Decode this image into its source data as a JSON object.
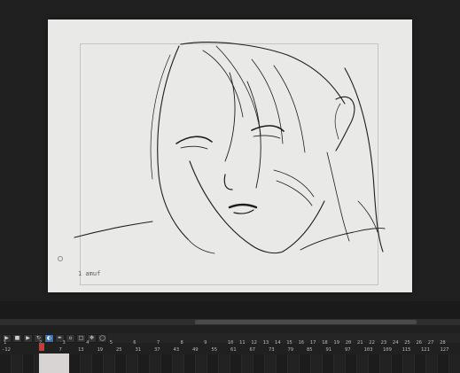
{
  "canvas": {
    "scene_label": "1 amuf",
    "line_color": "#1a1a1a",
    "paper_color": "#e9e9e7"
  },
  "timeline": {
    "toolbar_icons": [
      "play-icon",
      "stop-icon",
      "next-frame-icon",
      "loop-icon",
      "onion-skin-icon",
      "brush-icon",
      "eraser-icon",
      "select-icon",
      "move-icon",
      "zoom-icon"
    ],
    "upper_ticks": [
      "1",
      "",
      "",
      "2",
      "",
      "3",
      "",
      "4",
      "",
      "5",
      "",
      "6",
      "",
      "7",
      "",
      "8",
      "",
      "9",
      "",
      "10",
      "11",
      "12",
      "13",
      "14",
      "15",
      "16",
      "17",
      "18",
      "19",
      "20",
      "21",
      "22",
      "23",
      "24",
      "25",
      "26",
      "27",
      "28"
    ],
    "lower_ticks": [
      "-12",
      "",
      "1",
      "7",
      "13",
      "19",
      "25",
      "31",
      "37",
      "43",
      "49",
      "55",
      "61",
      "67",
      "73",
      "79",
      "85",
      "91",
      "97",
      "103",
      "109",
      "115",
      "121",
      "127"
    ],
    "accent_color": "#c53c3c"
  }
}
